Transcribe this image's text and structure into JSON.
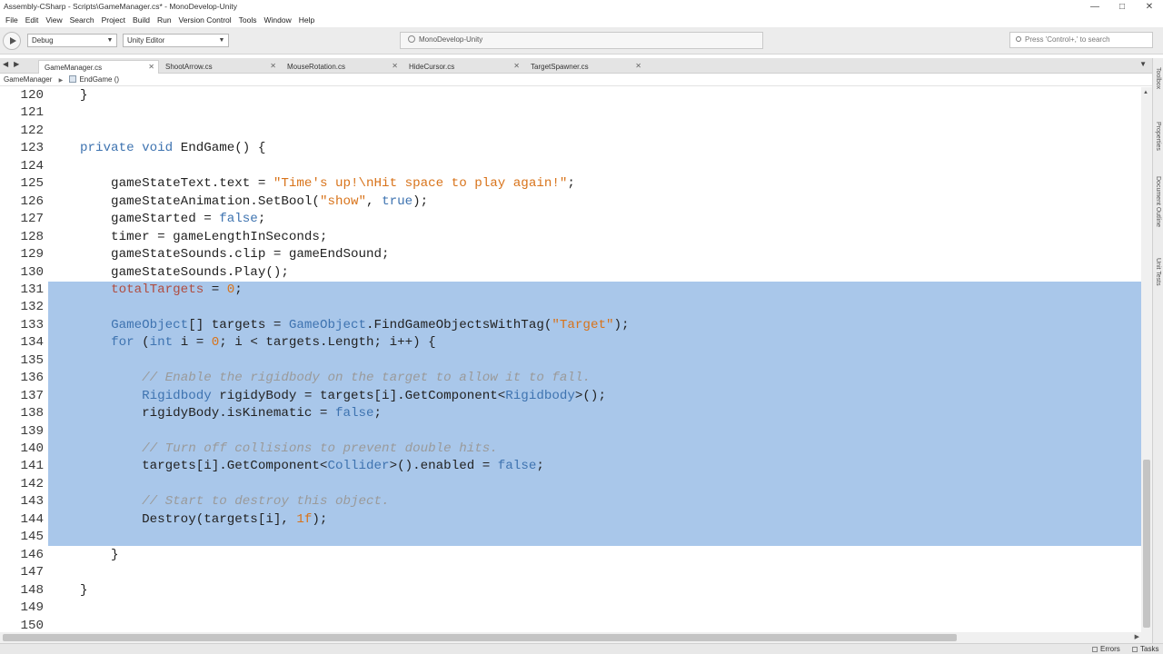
{
  "window": {
    "title": "Assembly-CSharp - Scripts\\GameManager.cs* - MonoDevelop-Unity"
  },
  "menu": [
    "File",
    "Edit",
    "View",
    "Search",
    "Project",
    "Build",
    "Run",
    "Version Control",
    "Tools",
    "Window",
    "Help"
  ],
  "toolbar": {
    "config": "Debug",
    "target": "Unity Editor",
    "status": "MonoDevelop-Unity",
    "search_placeholder": "Press 'Control+,' to search"
  },
  "tabs": [
    {
      "label": "GameManager.cs",
      "active": true
    },
    {
      "label": "ShootArrow.cs",
      "active": false
    },
    {
      "label": "MouseRotation.cs",
      "active": false
    },
    {
      "label": "HideCursor.cs",
      "active": false
    },
    {
      "label": "TargetSpawner.cs",
      "active": false
    }
  ],
  "breadcrumb": {
    "class_name": "GameManager",
    "method_name": "EndGame ()"
  },
  "right_panels": [
    "Toolbox",
    "Properties",
    "Document Outline",
    "Unit Tests"
  ],
  "status_bar": {
    "errors": "Errors",
    "tasks": "Tasks"
  },
  "code": {
    "lines": [
      {
        "n": "120",
        "t": "}"
      },
      {
        "n": "121",
        "t": ""
      },
      {
        "n": "122",
        "t": ""
      },
      {
        "n": "123",
        "t": "private void EndGame() {"
      },
      {
        "n": "124",
        "t": ""
      },
      {
        "n": "125",
        "t": "    gameStateText.text = \"Time's up!\\nHit space to play again!\";"
      },
      {
        "n": "126",
        "t": "    gameStateAnimation.SetBool(\"show\", true);"
      },
      {
        "n": "127",
        "t": "    gameStarted = false;"
      },
      {
        "n": "128",
        "t": "    timer = gameLengthInSeconds;"
      },
      {
        "n": "129",
        "t": "    gameStateSounds.clip = gameEndSound;"
      },
      {
        "n": "130",
        "t": "    gameStateSounds.Play();"
      },
      {
        "n": "131",
        "t": "    totalTargets = 0;"
      },
      {
        "n": "132",
        "t": ""
      },
      {
        "n": "133",
        "t": "    GameObject[] targets = GameObject.FindGameObjectsWithTag(\"Target\");"
      },
      {
        "n": "134",
        "t": "    for (int i = 0; i < targets.Length; i++) {"
      },
      {
        "n": "135",
        "t": ""
      },
      {
        "n": "136",
        "t": "        // Enable the rigidbody on the target to allow it to fall."
      },
      {
        "n": "137",
        "t": "        Rigidbody rigidyBody = targets[i].GetComponent<Rigidbody>();"
      },
      {
        "n": "138",
        "t": "        rigidyBody.isKinematic = false;"
      },
      {
        "n": "139",
        "t": ""
      },
      {
        "n": "140",
        "t": "        // Turn off collisions to prevent double hits."
      },
      {
        "n": "141",
        "t": "        targets[i].GetComponent<Collider>().enabled = false;"
      },
      {
        "n": "142",
        "t": ""
      },
      {
        "n": "143",
        "t": "        // Start to destroy this object."
      },
      {
        "n": "144",
        "t": "        Destroy(targets[i], 1f);"
      },
      {
        "n": "145",
        "t": ""
      },
      {
        "n": "146",
        "t": "    }"
      },
      {
        "n": "147",
        "t": ""
      },
      {
        "n": "148",
        "t": "}"
      },
      {
        "n": "149",
        "t": ""
      },
      {
        "n": "150",
        "t": ""
      }
    ]
  }
}
